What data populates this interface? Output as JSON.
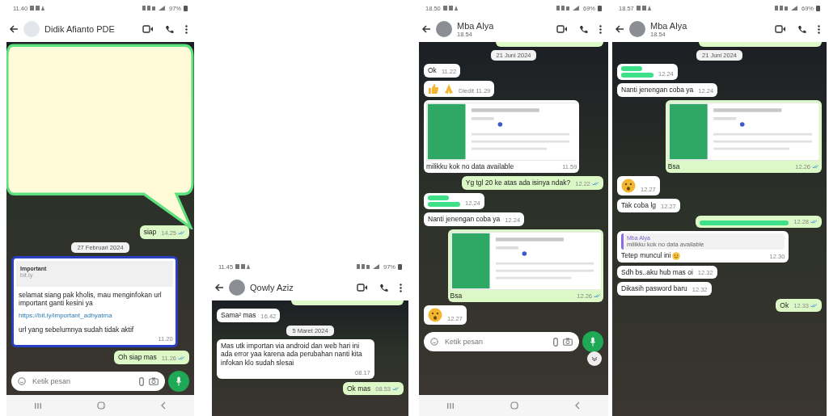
{
  "panels": [
    {
      "status": {
        "time": "11.40",
        "battery": "97%"
      },
      "header": {
        "name": "Didik Afianto PDE"
      },
      "callout": true,
      "messages": [
        {
          "kind": "text",
          "outgoing": true,
          "text": "siap",
          "time": "14.25"
        },
        {
          "kind": "date",
          "text": "27 Februari 2024"
        },
        {
          "kind": "card",
          "outgoing": false,
          "highlighted": true,
          "title": "Important",
          "subtitle": "bit.ly",
          "body": "selamat siang pak kholis, mau menginfokan url important ganti kesini ya",
          "link": "https://bit.ly/important_adhyatma",
          "footer": "url yang sebelumnya sudah tidak aktif",
          "time": "11.20"
        },
        {
          "kind": "text",
          "outgoing": true,
          "text": "Oh siap mas",
          "time": "11.26"
        }
      ],
      "input": {
        "placeholder": "Ketik pesan"
      },
      "nav": true
    },
    {
      "status": {
        "time": "11.45",
        "battery": "97%"
      },
      "header": {
        "name": "Qowly Aziz"
      },
      "callout": false,
      "messages": [
        {
          "kind": "cut",
          "outgoing": true
        },
        {
          "kind": "text",
          "outgoing": false,
          "text": "Sama² mas",
          "time": "16.42"
        },
        {
          "kind": "date",
          "text": "5 Maret 2024"
        },
        {
          "kind": "text",
          "outgoing": false,
          "text": "Mas utk importan via android dan web hari ini ada error yaa karena ada perubahan nanti kita infokan klo sudah slesai",
          "time": "08.17"
        },
        {
          "kind": "text",
          "outgoing": true,
          "text": "Ok mas",
          "time": "08.53"
        }
      ],
      "nav": false
    },
    {
      "status": {
        "time": "18.50",
        "battery": "69%"
      },
      "header": {
        "name": "Mba Alya",
        "subtitle": "18.54"
      },
      "callout": false,
      "messages": [
        {
          "kind": "cut",
          "outgoing": true
        },
        {
          "kind": "date",
          "text": "21 Juni 2024"
        },
        {
          "kind": "text",
          "outgoing": false,
          "text": "Ok",
          "time": "11.22"
        },
        {
          "kind": "gesture_emoji",
          "outgoing": false,
          "time": "Diedit 11.29"
        },
        {
          "kind": "image",
          "outgoing": false,
          "text": "milikku kok no data available",
          "time": "11.59"
        },
        {
          "kind": "text",
          "outgoing": true,
          "text": "Yg tgl 20 ke atas ada isinya ndak?",
          "time": "12.22"
        },
        {
          "kind": "redacted",
          "outgoing": false,
          "time": "12.24"
        },
        {
          "kind": "text",
          "outgoing": false,
          "text": "Nanti jenengan coba ya",
          "time": "12.24"
        },
        {
          "kind": "image",
          "outgoing": true,
          "text": "Bsa",
          "time": "12.26"
        },
        {
          "kind": "face_emoji",
          "outgoing": false,
          "time": "12.27"
        }
      ],
      "input": {
        "placeholder": "Ketik pesan"
      },
      "scroll_button": true,
      "nav": true
    },
    {
      "status": {
        "time": "18.57",
        "battery": "69%"
      },
      "header": {
        "name": "Mba Alya",
        "subtitle": "18.54"
      },
      "callout": false,
      "messages": [
        {
          "kind": "cut",
          "outgoing": true
        },
        {
          "kind": "date",
          "text": "21 Juni 2024"
        },
        {
          "kind": "redacted",
          "outgoing": false,
          "time": "12.24"
        },
        {
          "kind": "text",
          "outgoing": false,
          "text": "Nanti jenengan coba ya",
          "time": "12.24"
        },
        {
          "kind": "image",
          "outgoing": true,
          "text": "Bsa",
          "time": "12.26"
        },
        {
          "kind": "face_emoji",
          "outgoing": false,
          "time": "12.27"
        },
        {
          "kind": "text",
          "outgoing": false,
          "text": "Tak coba lg",
          "time": "12.27"
        },
        {
          "kind": "redacted",
          "outgoing": true,
          "time": "12.28"
        },
        {
          "kind": "reply",
          "outgoing": false,
          "quote_name": "Mba Alya",
          "quote_text": "milikku kok no data available",
          "text": "Tetep muncul ini",
          "emoji_after": true,
          "time": "12.30"
        },
        {
          "kind": "text",
          "outgoing": false,
          "text": "Sdh bs..aku hub mas oi",
          "time": "12.32"
        },
        {
          "kind": "text",
          "outgoing": false,
          "text": "Dikasih pasword baru",
          "time": "12.32"
        },
        {
          "kind": "text",
          "outgoing": true,
          "text": "Ok",
          "time": "12.33"
        }
      ],
      "nav": false
    }
  ]
}
